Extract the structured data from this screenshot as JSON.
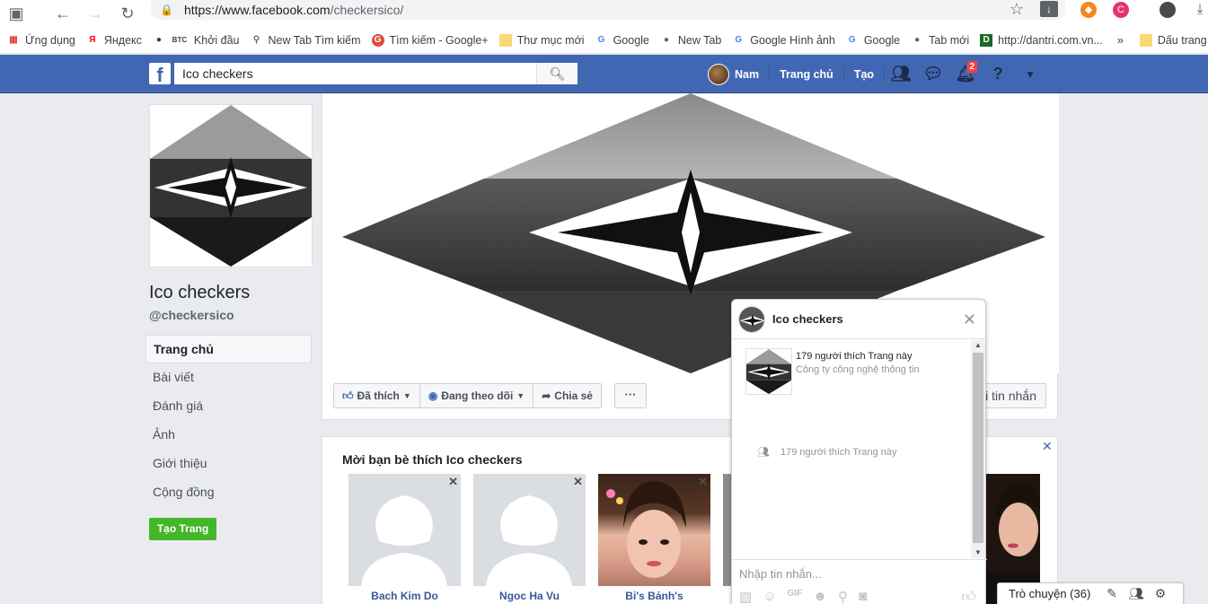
{
  "browser": {
    "url_host": "https://www.facebook.com",
    "url_path": "/checkersico/",
    "bookmarks": [
      {
        "label": "Ứng dụng",
        "icon": "apps-grid-icon",
        "color": "#ea4335"
      },
      {
        "label": "Яндекс",
        "icon": "yandex-icon",
        "color": "#ff0000"
      },
      {
        "label": "Khởi đầu",
        "icon": "btc-icon",
        "color": "#000000"
      },
      {
        "label": "New Tab Tìm kiếm",
        "icon": "search-icon",
        "color": "#5f6368"
      },
      {
        "label": "Tìm kiếm - Google+",
        "icon": "google-plus-icon",
        "color": "#dd4b39"
      },
      {
        "label": "Thư mục mới",
        "icon": "folder-icon",
        "color": "#f9d976"
      },
      {
        "label": "Google",
        "icon": "google-icon",
        "color": "#4285f4"
      },
      {
        "label": "New Tab",
        "icon": "globe-icon",
        "color": "#5f6368"
      },
      {
        "label": "Google Hình ảnh",
        "icon": "google-icon",
        "color": "#4285f4"
      },
      {
        "label": "Google",
        "icon": "google-icon",
        "color": "#4285f4"
      },
      {
        "label": "Tab mới",
        "icon": "globe-icon",
        "color": "#5f6368"
      },
      {
        "label": "http://dantri.com.vn...",
        "icon": "dantri-icon",
        "color": "#1a6a2a"
      }
    ],
    "overflow_label": "»",
    "other_bookmarks": "Dấu trang khá"
  },
  "fb": {
    "search_value": "Ico checkers",
    "user_name": "Nam",
    "nav_home": "Trang chủ",
    "nav_create": "Tạo",
    "notif_count": "2",
    "brand_color": "#4267b2"
  },
  "page": {
    "name": "Ico checkers",
    "handle": "@checkersico",
    "nav": [
      "Trang chủ",
      "Bài viết",
      "Đánh giá",
      "Ảnh",
      "Giới thiệu",
      "Cộng đồng"
    ],
    "create_page": "Tạo Trang",
    "actions": {
      "liked": "Đã thích",
      "following": "Đang theo dõi",
      "share": "Chia sẻ",
      "more": "···",
      "message": "i tin nhắn"
    }
  },
  "invite": {
    "title": "Mời bạn bè thích Ico checkers",
    "friends": [
      "Bach Kim Do",
      "Ngoc Ha Vu",
      "Bi's Bảnh's"
    ]
  },
  "chat": {
    "title": "Ico checkers",
    "likes": "179 người thích Trang này",
    "category": "Công ty công nghệ thông tin",
    "summary": "179 người thích Trang này",
    "input_placeholder": "Nhập tin nhắn...",
    "sidebar_label": "Trò chuyện (36)"
  }
}
